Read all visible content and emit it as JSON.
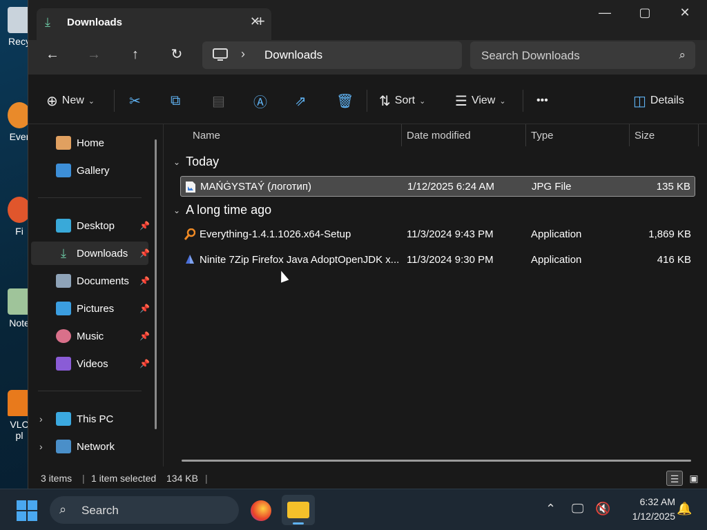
{
  "desktop": {
    "icons": [
      {
        "label": "Recy",
        "name": "recycle-bin"
      },
      {
        "label": "Ever",
        "name": "everything-shortcut"
      },
      {
        "label": "Fi",
        "name": "firefox-shortcut"
      },
      {
        "label": "Note",
        "name": "notepad-shortcut"
      },
      {
        "label": "VLC",
        "sublabel": "pl",
        "name": "vlc-shortcut"
      }
    ]
  },
  "window": {
    "tab_title": "Downloads",
    "new_tab": "+",
    "address": {
      "crumb": "Downloads"
    },
    "search_placeholder": "Search Downloads"
  },
  "toolbar": {
    "new_label": "New",
    "sort_label": "Sort",
    "view_label": "View",
    "more_label": "•••",
    "details_label": "Details"
  },
  "sidebar": {
    "home": "Home",
    "gallery": "Gallery",
    "desktop": "Desktop",
    "downloads": "Downloads",
    "documents": "Documents",
    "pictures": "Pictures",
    "music": "Music",
    "videos": "Videos",
    "this_pc": "This PC",
    "network": "Network"
  },
  "columns": {
    "name": "Name",
    "date": "Date modified",
    "type": "Type",
    "size": "Size"
  },
  "groups": [
    {
      "label": "Today",
      "files": [
        {
          "name": "MAŃĠYSTAÝ (логотип)",
          "date": "1/12/2025 6:24 AM",
          "type": "JPG File",
          "size": "135 KB",
          "selected": true
        }
      ]
    },
    {
      "label": "A long time ago",
      "files": [
        {
          "name": "Everything-1.4.1.1026.x64-Setup",
          "date": "11/3/2024 9:43 PM",
          "type": "Application",
          "size": "1,869 KB"
        },
        {
          "name": "Ninite 7Zip Firefox Java AdoptOpenJDK x...",
          "date": "11/3/2024 9:30 PM",
          "type": "Application",
          "size": "416 KB"
        }
      ]
    }
  ],
  "status": {
    "items": "3 items",
    "selected": "1 item selected",
    "size": "134 KB"
  },
  "taskbar": {
    "search": "Search",
    "time": "6:32 AM",
    "date": "1/12/2025"
  },
  "colors": {
    "accent": "#5fb2f2",
    "selected_row": "#4a4a4a",
    "window_bg": "#191919"
  }
}
